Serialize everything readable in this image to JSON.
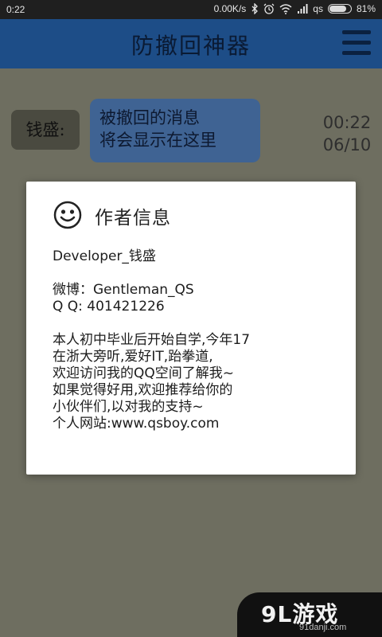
{
  "status_bar": {
    "time": "0:22",
    "net_speed": "0.00K/s",
    "carrier": "qs",
    "battery_percent": "81%",
    "battery_level": 0.81,
    "icons": [
      "bluetooth-icon",
      "alarm-icon",
      "wifi-icon",
      "signal-icon",
      "battery-icon"
    ]
  },
  "app_bar": {
    "title": "防撤回神器",
    "menu_icon": "hamburger-menu-icon"
  },
  "chat": {
    "sender": "钱盛:",
    "message_lines": [
      "被撤回的消息",
      "将会显示在这里"
    ],
    "time": "00:22",
    "date": "06/10"
  },
  "dialog": {
    "icon": "smiley-icon",
    "title": "作者信息",
    "developer": "Developer_钱盛",
    "weibo": "微博：Gentleman_QS",
    "qq": "Q Q: 401421226",
    "bio_lines": [
      "本人初中毕业后开始自学,今年17",
      "在浙大旁听,爱好IT,跆拳道,",
      "欢迎访问我的QQ空间了解我~",
      "如果觉得好用,欢迎推荐给你的",
      "小伙伴们,以对我的支持~",
      "个人网站:www.qsboy.com"
    ]
  },
  "watermark": {
    "logo": "9L游戏",
    "domain": "91danji.com"
  },
  "colors": {
    "status_bar": "#1f1f1f",
    "app_bar": "#1d4d87",
    "background_dim": "#6e6e60",
    "bubble": "#3f6393",
    "sender_chip": "#4a4a40",
    "dialog": "#ffffff"
  }
}
